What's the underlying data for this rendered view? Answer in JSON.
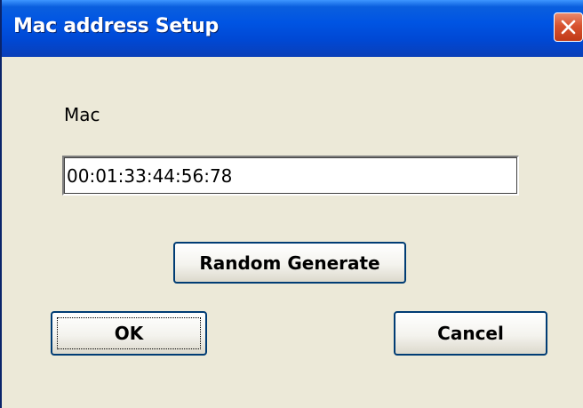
{
  "window": {
    "title": "Mac address Setup"
  },
  "form": {
    "mac_label": "Mac",
    "mac_value": "00:01:33:44:56:78"
  },
  "buttons": {
    "random_generate": "Random Generate",
    "ok": "OK",
    "cancel": "Cancel"
  },
  "icons": {
    "close": "close-icon"
  },
  "colors": {
    "titlebar": "#0054e3",
    "close_button": "#d8532f",
    "window_background": "#ece9d8",
    "button_border": "#003c74"
  }
}
